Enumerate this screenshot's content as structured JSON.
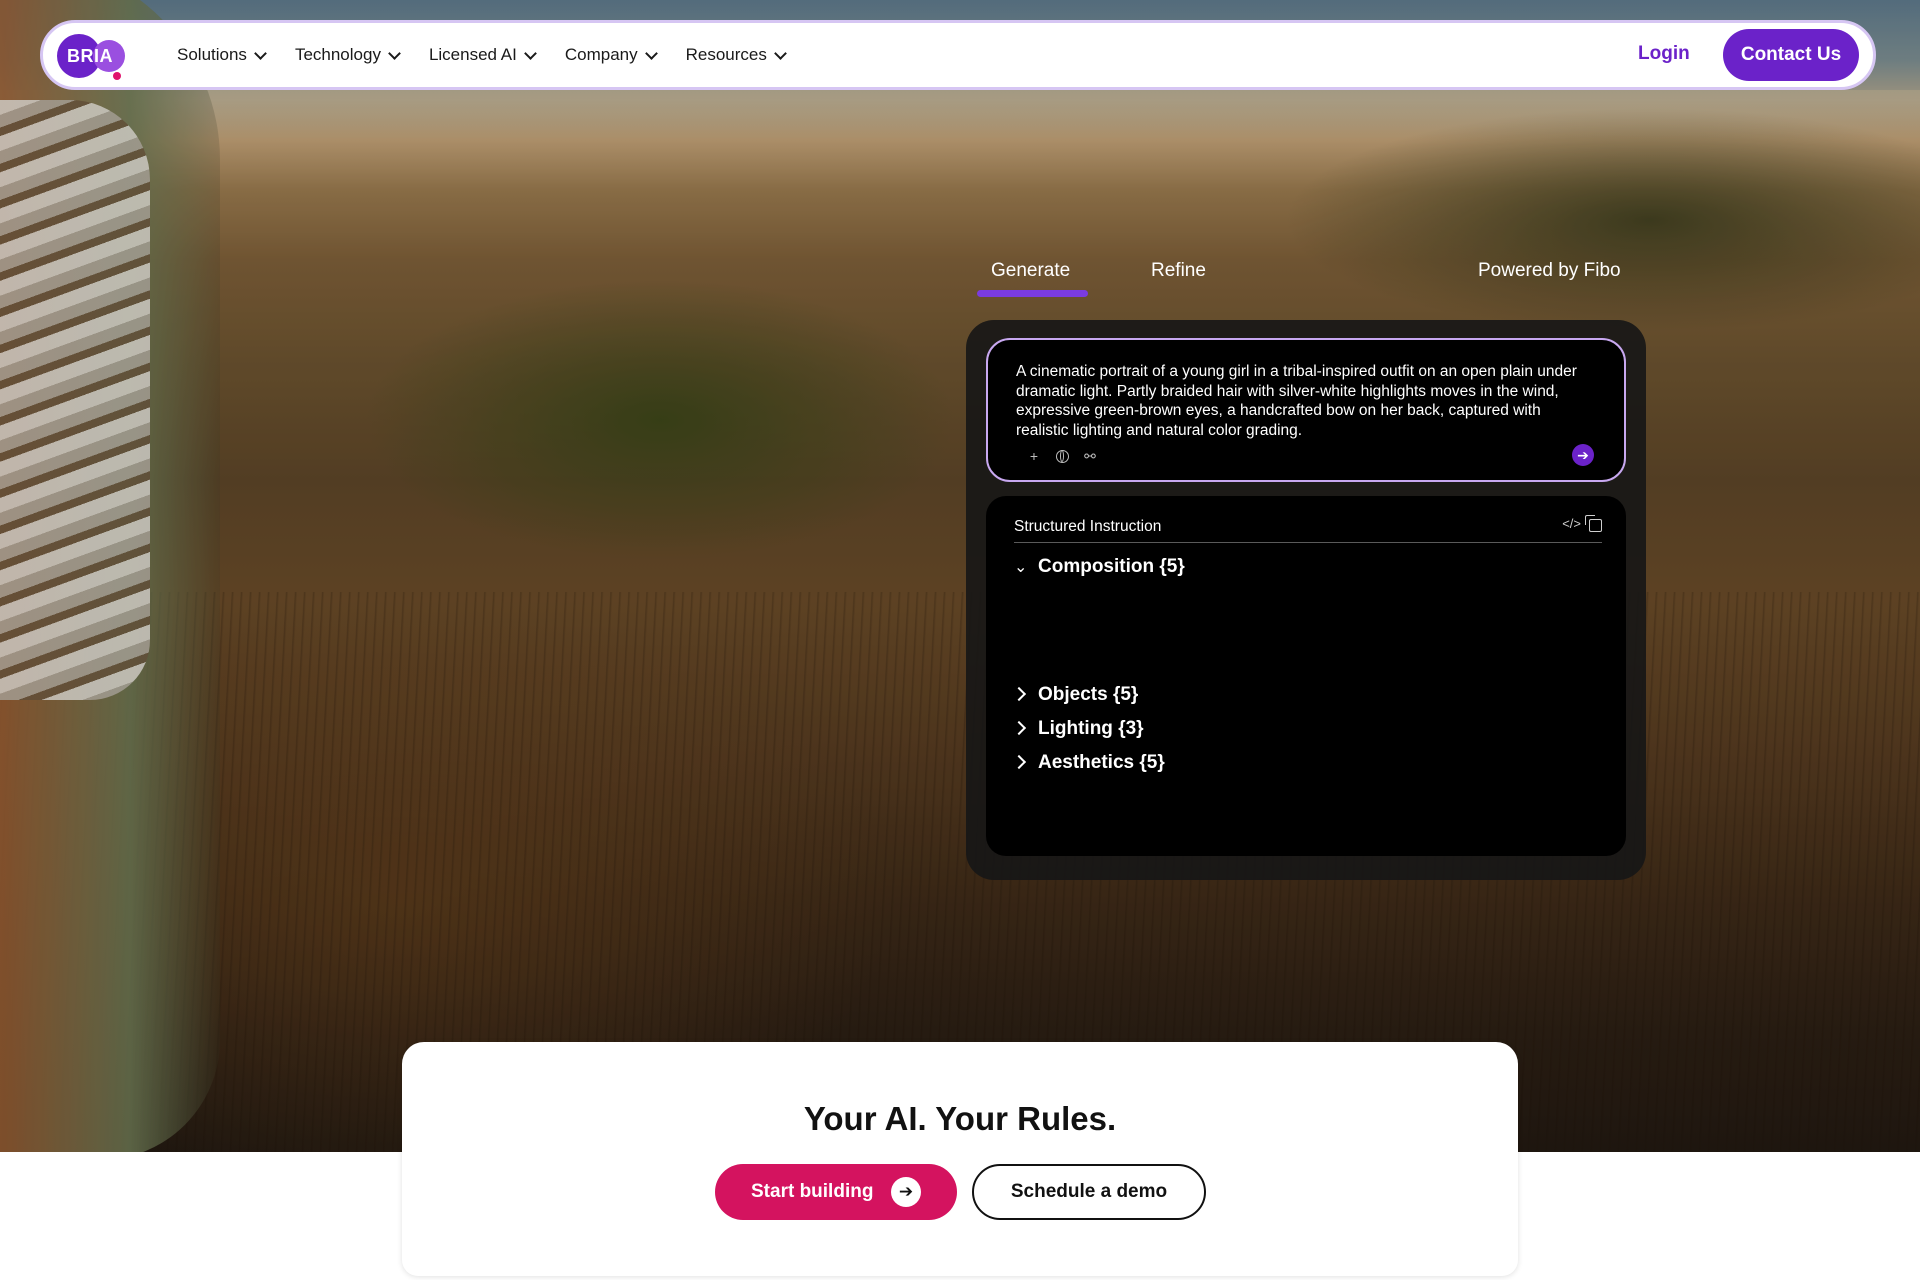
{
  "brand": {
    "logo_text": "BRIA",
    "accent": "#6b22c9",
    "cta_color": "#d4135f"
  },
  "nav": {
    "items": [
      {
        "label": "Solutions"
      },
      {
        "label": "Technology"
      },
      {
        "label": "Licensed AI"
      },
      {
        "label": "Company"
      },
      {
        "label": "Resources"
      }
    ],
    "login_label": "Login",
    "contact_label": "Contact Us"
  },
  "tabs": {
    "generate": "Generate",
    "refine": "Refine",
    "powered_by": "Powered by Fibo"
  },
  "prompt": {
    "text": "A cinematic portrait of a young girl in a tribal-inspired outfit on an open plain under dramatic light. Partly braided hair with silver-white highlights moves in the wind, expressive green-brown eyes, a handcrafted bow on her back, captured with realistic lighting and natural color grading."
  },
  "structured": {
    "title": "Structured Instruction",
    "sections": [
      {
        "label": "Composition {5}",
        "expanded": true
      },
      {
        "label": "Objects {5}",
        "expanded": false
      },
      {
        "label": "Lighting {3}",
        "expanded": false
      },
      {
        "label": "Aesthetics {5}",
        "expanded": false
      }
    ]
  },
  "cta": {
    "title": "Your AI. Your Rules.",
    "start_label": "Start building",
    "demo_label": "Schedule a demo"
  }
}
